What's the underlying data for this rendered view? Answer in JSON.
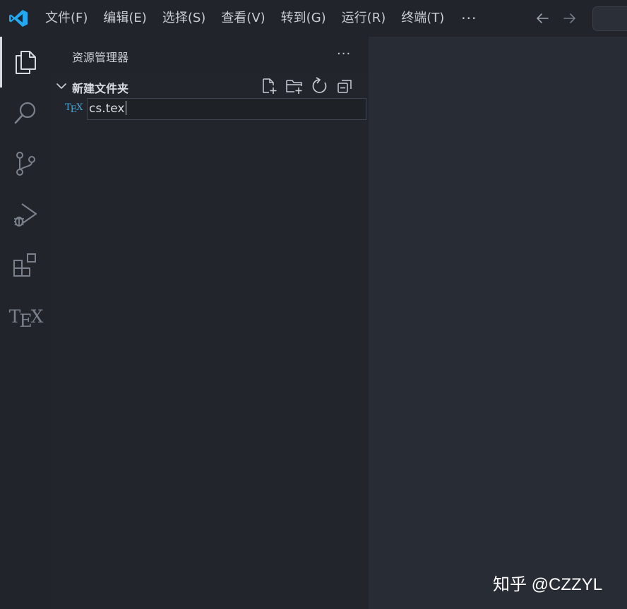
{
  "menu": {
    "items": [
      "文件(F)",
      "编辑(E)",
      "选择(S)",
      "查看(V)",
      "转到(G)",
      "运行(R)",
      "终端(T)"
    ],
    "more": "···"
  },
  "activity_bar": {
    "items": [
      "explorer",
      "search",
      "source-control",
      "run-and-debug",
      "extensions",
      "tex"
    ],
    "tex_label_t": "T",
    "tex_label_e": "E",
    "tex_label_x": "X"
  },
  "sidebar": {
    "title": "资源管理器",
    "more": "···",
    "folder": {
      "name": "新建文件夹"
    },
    "file": {
      "icon_t": "T",
      "icon_e": "E",
      "icon_x": "X",
      "name": "cs.tex"
    }
  },
  "watermark": "知乎 @CZZYL",
  "colors": {
    "accent": "#23a9f2",
    "tex_icon": "#4aa8d8",
    "background": "#21252b",
    "editor": "#282c34"
  }
}
